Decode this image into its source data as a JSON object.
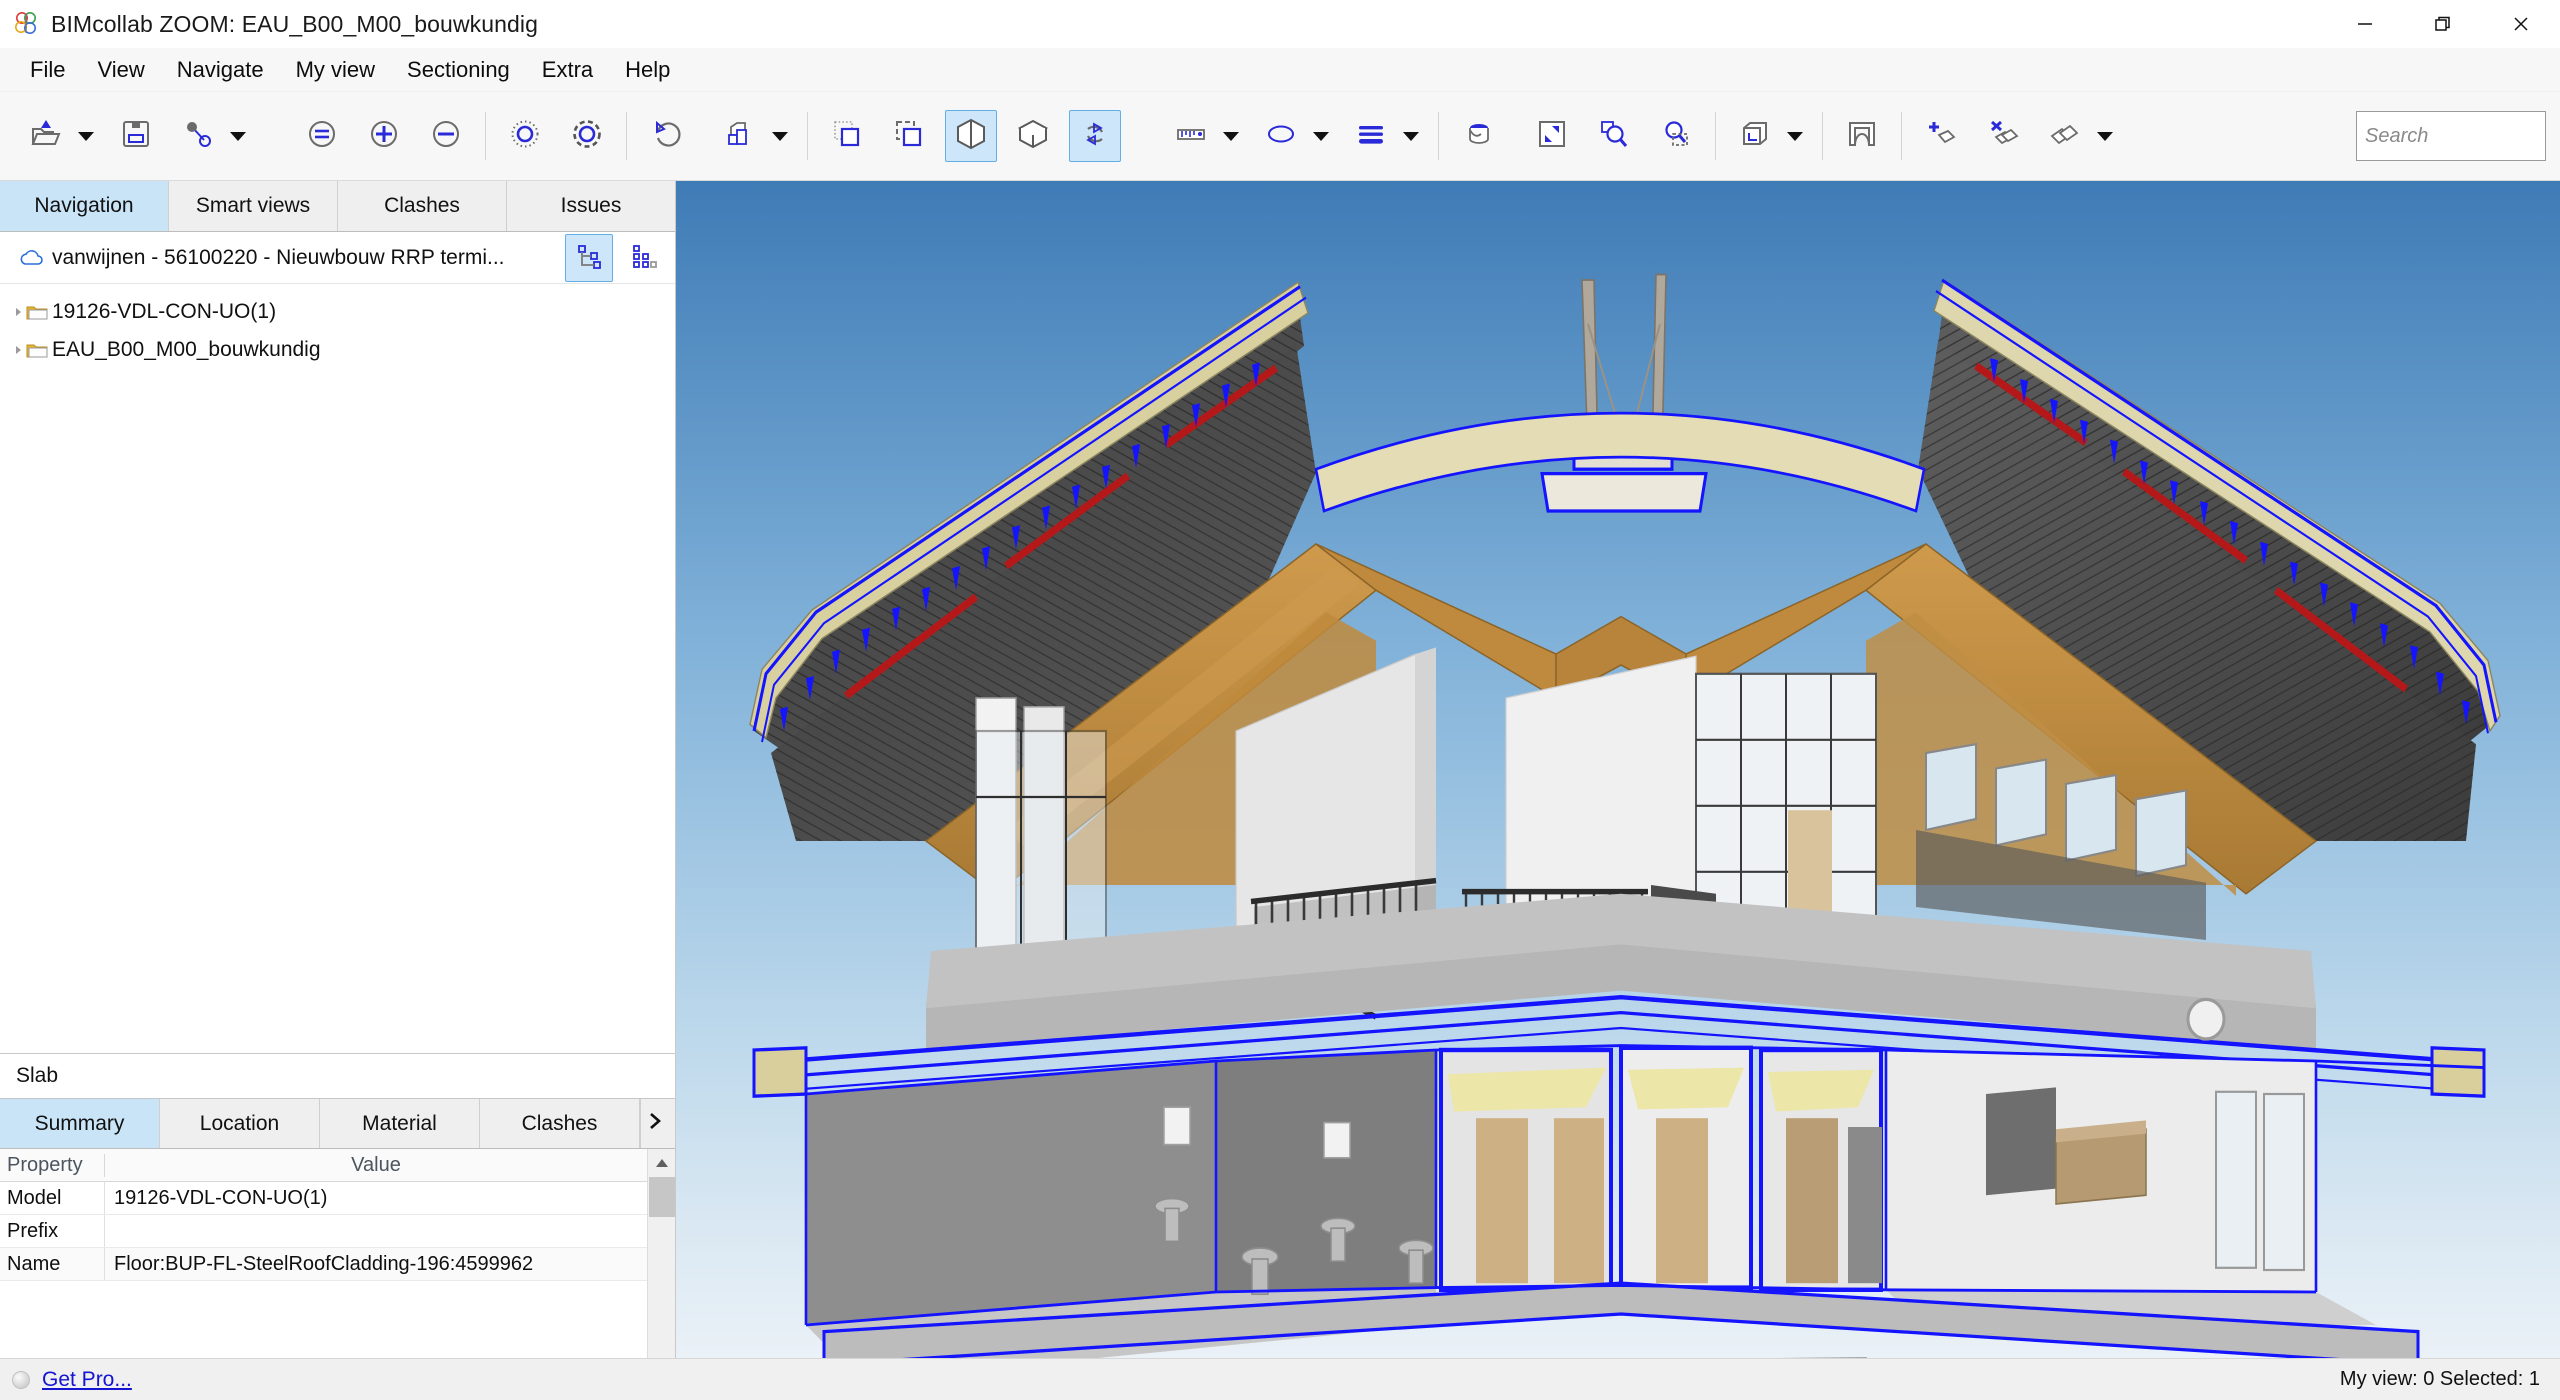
{
  "window": {
    "title": "BIMcollab ZOOM: EAU_B00_M00_bouwkundig",
    "logo_icon": "bimcollab-logo-icon",
    "minimize_icon": "minimize-icon",
    "restore_icon": "restore-icon",
    "close_icon": "close-icon"
  },
  "menubar": {
    "items": [
      {
        "label": "File"
      },
      {
        "label": "View"
      },
      {
        "label": "Navigate"
      },
      {
        "label": "My view"
      },
      {
        "label": "Sectioning"
      },
      {
        "label": "Extra"
      },
      {
        "label": "Help"
      }
    ]
  },
  "toolbar": {
    "buttons": [
      {
        "name": "open-project-icon",
        "tooltip": "Open project"
      },
      {
        "name": "open-dropdown-caret",
        "tooltip": "Open options"
      },
      {
        "name": "save-icon",
        "tooltip": "Save"
      },
      {
        "name": "link-icon",
        "tooltip": "Link"
      },
      {
        "name": "link-dropdown-caret",
        "tooltip": "Link options"
      },
      {
        "name": "zoom-fit-icon",
        "tooltip": "Zoom to fit"
      },
      {
        "name": "zoom-in-icon",
        "tooltip": "Zoom in"
      },
      {
        "name": "zoom-out-icon",
        "tooltip": "Zoom out"
      },
      {
        "name": "select-loose-icon",
        "tooltip": "Select loose"
      },
      {
        "name": "select-dense-icon",
        "tooltip": "Select dense"
      },
      {
        "name": "undo-icon",
        "tooltip": "Undo"
      },
      {
        "name": "isolate-icon",
        "tooltip": "Isolate"
      },
      {
        "name": "isolate-dropdown-caret",
        "tooltip": "Isolate options"
      },
      {
        "name": "select-inside-icon",
        "tooltip": "Select inside window"
      },
      {
        "name": "select-crossing-icon",
        "tooltip": "Select crossing window"
      },
      {
        "name": "section-view-icon",
        "tooltip": "Section view"
      },
      {
        "name": "box-view-icon",
        "tooltip": "3D box view"
      },
      {
        "name": "orbit-icon",
        "tooltip": "Orbit / rotate"
      },
      {
        "name": "measure-icon",
        "tooltip": "Measure"
      },
      {
        "name": "measure-dropdown-caret",
        "tooltip": "Measure options"
      },
      {
        "name": "markup-ellipse-icon",
        "tooltip": "Ellipse markup"
      },
      {
        "name": "markup-dropdown-caret",
        "tooltip": "Markup options"
      },
      {
        "name": "layers-icon",
        "tooltip": "Layers"
      },
      {
        "name": "layers-dropdown-caret",
        "tooltip": "Layer options"
      },
      {
        "name": "paint-bucket-icon",
        "tooltip": "Paint"
      },
      {
        "name": "fullscreen-icon",
        "tooltip": "Full screen"
      },
      {
        "name": "zoom-window-icon",
        "tooltip": "Zoom window"
      },
      {
        "name": "zoom-selection-icon",
        "tooltip": "Zoom to selection"
      },
      {
        "name": "clip-box-icon",
        "tooltip": "Clipping box"
      },
      {
        "name": "clip-dropdown-caret",
        "tooltip": "Clipping options"
      },
      {
        "name": "section-plane-icon",
        "tooltip": "Section plane"
      },
      {
        "name": "add-smartview-icon",
        "tooltip": "Add smart view"
      },
      {
        "name": "remove-smartview-icon",
        "tooltip": "Remove smart view"
      },
      {
        "name": "smartviews-icon",
        "tooltip": "Smart views"
      },
      {
        "name": "smartviews-dropdown-caret",
        "tooltip": "Smart view options"
      }
    ],
    "search": {
      "placeholder": "Search",
      "value": "",
      "name": "search-input"
    }
  },
  "left_panel": {
    "tabs": [
      {
        "label": "Navigation",
        "active": true
      },
      {
        "label": "Smart views",
        "active": false
      },
      {
        "label": "Clashes",
        "active": false
      },
      {
        "label": "Issues",
        "active": false
      }
    ],
    "project": {
      "label": "vanwijnen  -  56100220  -  Nieuwbouw RRP  termi...",
      "cloud_icon": "cloud-icon",
      "tools": [
        {
          "name": "tree-view-toggle",
          "icon": "tree-structure-icon",
          "active": true
        },
        {
          "name": "grid-view-toggle",
          "icon": "grid-dots-icon",
          "active": false
        }
      ]
    },
    "tree": [
      {
        "label": "19126-VDL-CON-UO(1)",
        "icon": "folder-icon"
      },
      {
        "label": "EAU_B00_M00_bouwkundig",
        "icon": "folder-icon"
      }
    ]
  },
  "properties": {
    "title": "Slab",
    "tabs": [
      {
        "label": "Summary",
        "active": true
      },
      {
        "label": "Location",
        "active": false
      },
      {
        "label": "Material",
        "active": false
      },
      {
        "label": "Clashes",
        "active": false
      }
    ],
    "more_icon": "chevron-right-icon",
    "columns": {
      "property": "Property",
      "value": "Value"
    },
    "rows": [
      {
        "property": "Model",
        "value": "19126-VDL-CON-UO(1)"
      },
      {
        "property": "Prefix",
        "value": ""
      },
      {
        "property": "Name",
        "value": "Floor:BUP-FL-SteelRoofCladding-196:4599962"
      }
    ],
    "scroll": {
      "up_icon": "scroll-up-arrow-icon",
      "down_icon": "scroll-down-arrow-icon"
    }
  },
  "statusbar": {
    "indicator_name": "status-indicator",
    "get_pro_label": "Get Pro...",
    "right_label": "My view: 0  Selected: 1"
  },
  "viewport": {
    "name": "3d-viewport",
    "model_title": "EAU_B00_M00_bouwkundig",
    "sky_top_color": "#3f7bb6",
    "sky_bottom_color": "#eaf1f7",
    "selection_color": "#1414ff",
    "beam_color": "#c08a3e",
    "roof_dark_color": "#4a4a4a",
    "accent_red_color": "#c21a1a",
    "floor_color": "#b0b0b0",
    "wall_color": "#e9e9e9"
  }
}
